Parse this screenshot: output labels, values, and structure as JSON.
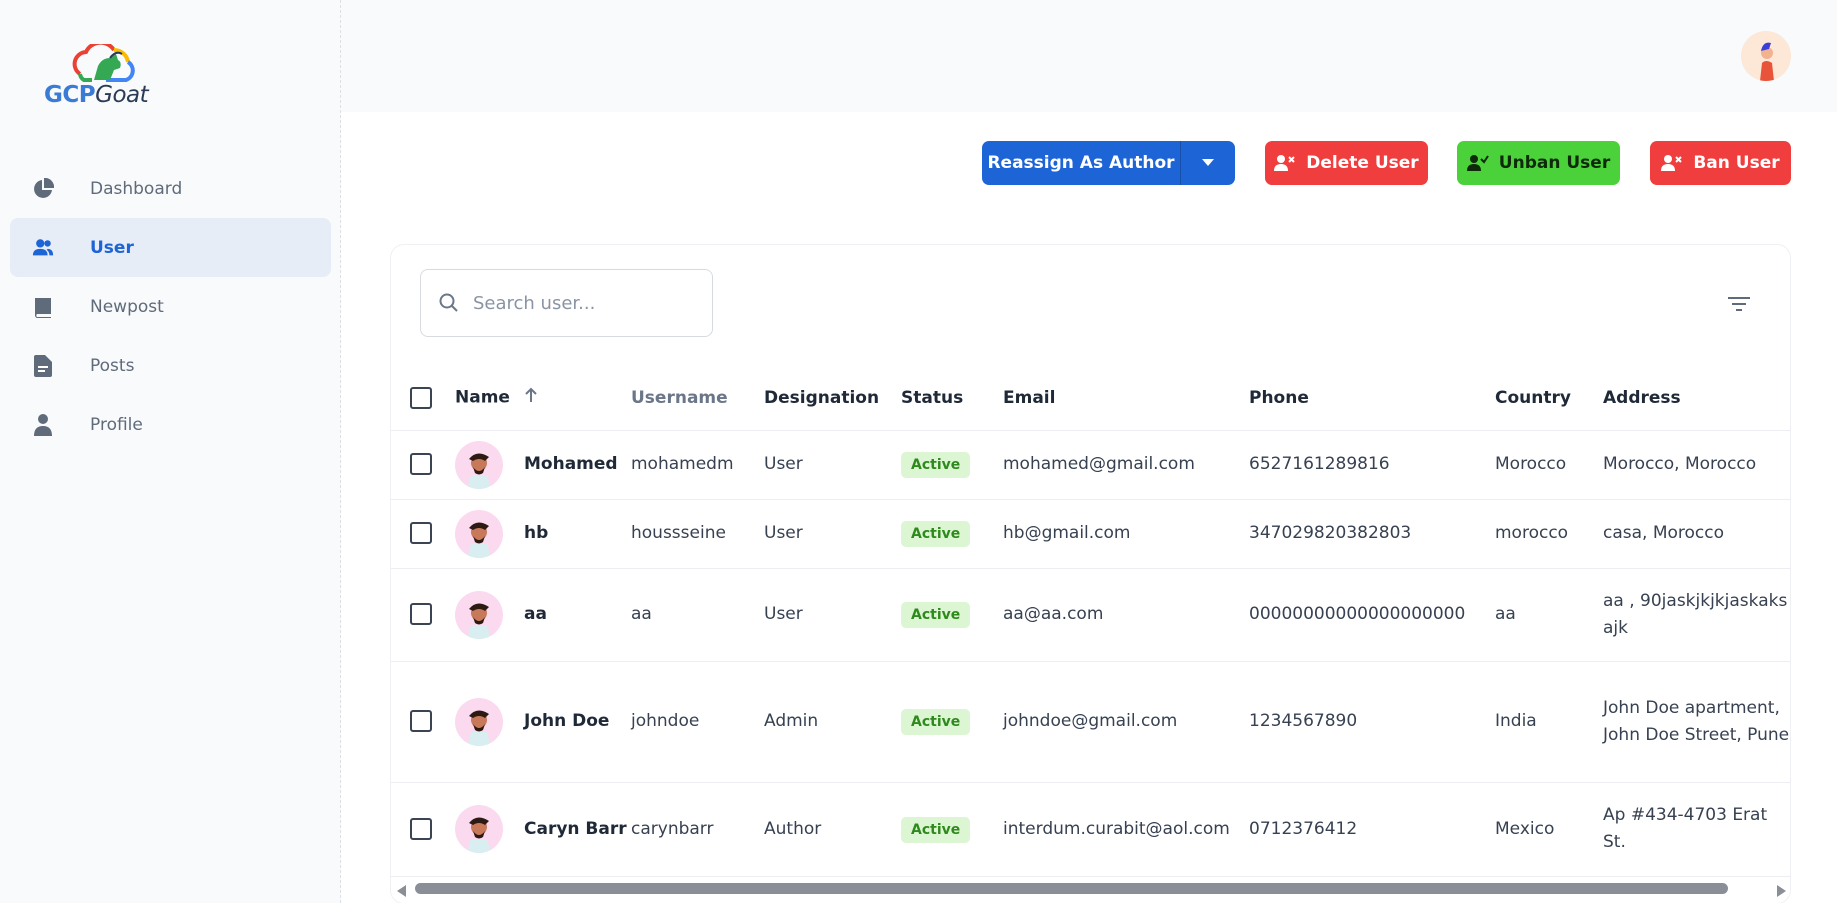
{
  "brand": {
    "part1": "GCP",
    "part2": "Goat"
  },
  "sidebar": {
    "items": [
      {
        "label": "Dashboard",
        "icon": "pie-chart-icon",
        "active": false
      },
      {
        "label": "User",
        "icon": "users-icon",
        "active": true
      },
      {
        "label": "Newpost",
        "icon": "book-icon",
        "active": false
      },
      {
        "label": "Posts",
        "icon": "document-icon",
        "active": false
      },
      {
        "label": "Profile",
        "icon": "person-icon",
        "active": false
      }
    ]
  },
  "toolbar": {
    "reassign_label": "Reassign As Author",
    "delete_label": "Delete User",
    "unban_label": "Unban User",
    "ban_label": "Ban User"
  },
  "search": {
    "placeholder": "Search user..."
  },
  "table": {
    "headers": {
      "name": "Name",
      "username": "Username",
      "designation": "Designation",
      "status": "Status",
      "email": "Email",
      "phone": "Phone",
      "country": "Country",
      "address": "Address"
    },
    "rows": [
      {
        "name": "Mohamed",
        "username": "mohamedm",
        "designation": "User",
        "status": "Active",
        "email": "mohamed@gmail.com",
        "phone": "6527161289816",
        "country": "Morocco",
        "address": "Morocco, Morocco"
      },
      {
        "name": "hb",
        "username": "houssseine",
        "designation": "User",
        "status": "Active",
        "email": "hb@gmail.com",
        "phone": "347029820382803",
        "country": "morocco",
        "address": "casa, Morocco"
      },
      {
        "name": "aa",
        "username": "aa",
        "designation": "User",
        "status": "Active",
        "email": "aa@aa.com",
        "phone": "00000000000000000000",
        "country": "aa",
        "address": "aa , 90jaskjkjkjaskaksajk"
      },
      {
        "name": "John Doe",
        "username": "johndoe",
        "designation": "Admin",
        "status": "Active",
        "email": "johndoe@gmail.com",
        "phone": "1234567890",
        "country": "India",
        "address": "John Doe apartment, John Doe Street, Pune"
      },
      {
        "name": "Caryn Barr",
        "username": "carynbarr",
        "designation": "Author",
        "status": "Active",
        "email": "interdum.curabit@aol.com",
        "phone": "0712376412",
        "country": "Mexico",
        "address": "Ap #434-4703 Erat St."
      }
    ]
  },
  "colors": {
    "primary": "#1d64d6",
    "danger": "#f03e3e",
    "success": "#4bd13a",
    "active_badge_bg": "#dcf5d3",
    "active_badge_text": "#2f8a1d"
  }
}
